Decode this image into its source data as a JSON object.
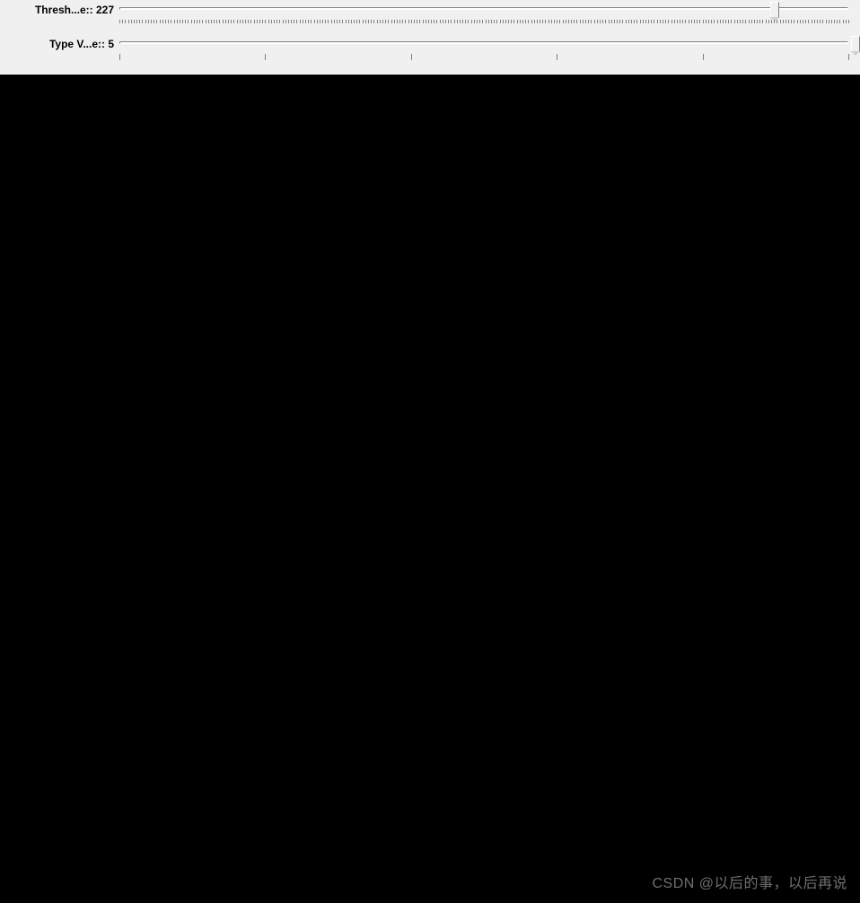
{
  "controls": {
    "threshold": {
      "label": "Thresh...e:: 227",
      "value": 227,
      "min": 0,
      "max": 255,
      "thumb_percent": 89,
      "tick_count": 256,
      "major_tick_interval": 0
    },
    "type": {
      "label": "Type V...e:: 5",
      "value": 5,
      "min": 0,
      "max": 5,
      "thumb_percent": 100,
      "tick_count": 6,
      "major_tick_interval": 1
    }
  },
  "watermark": "CSDN @以后的事，以后再说"
}
